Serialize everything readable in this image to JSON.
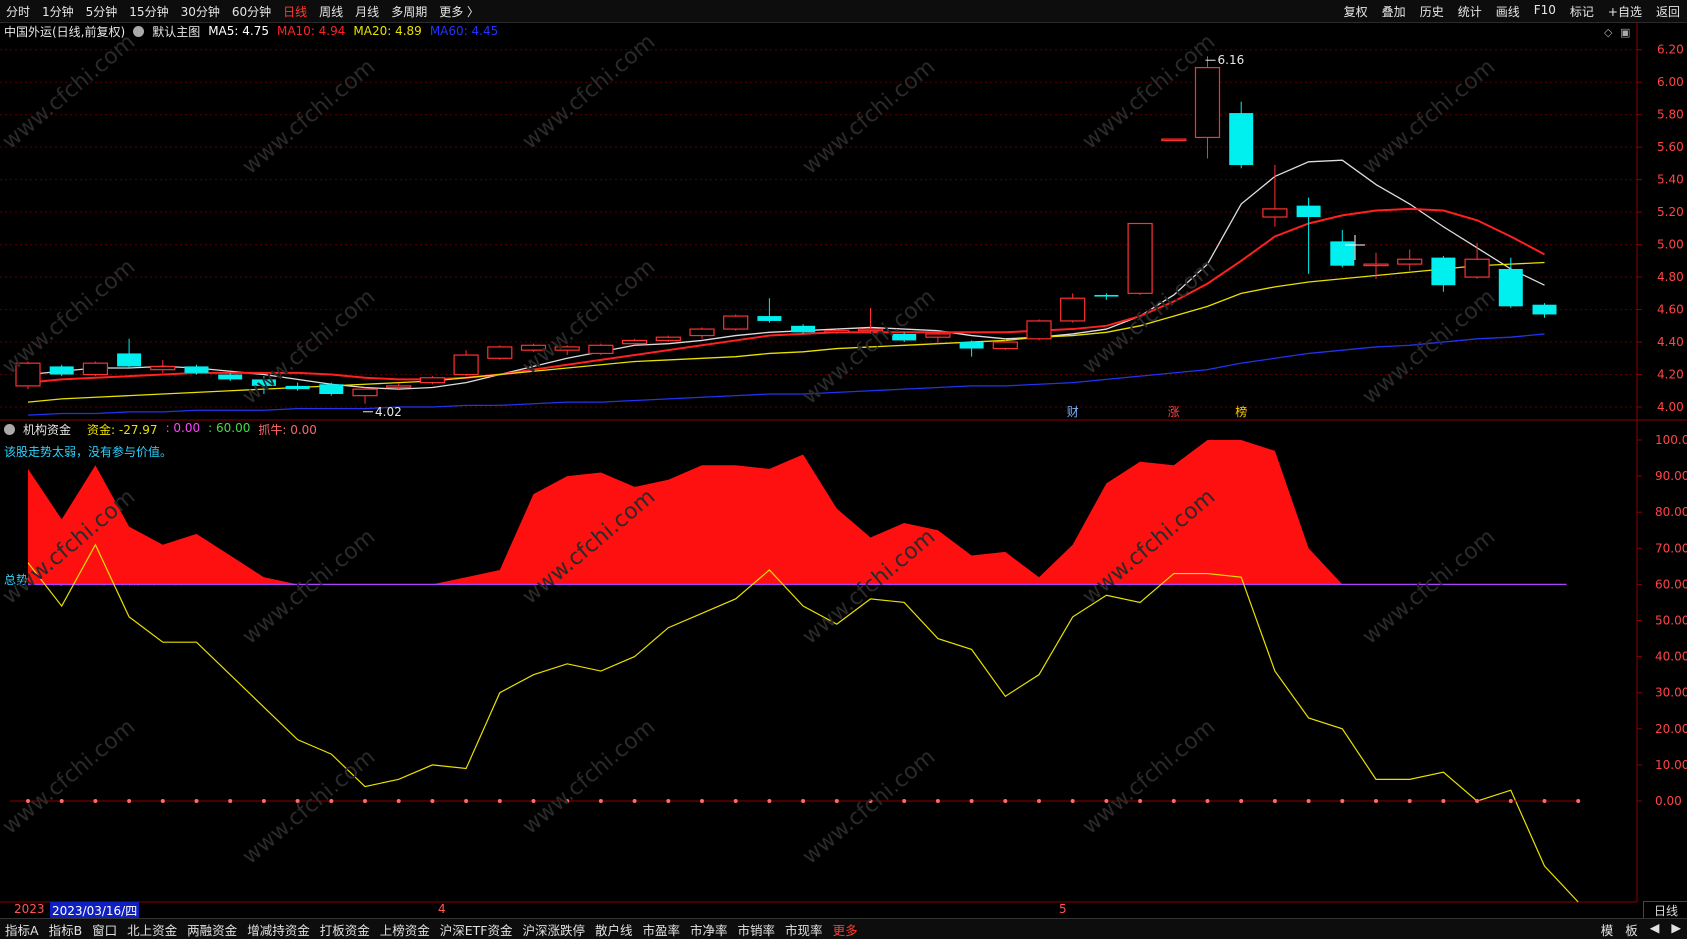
{
  "topbar": {
    "tabs": [
      "分时",
      "1分钟",
      "5分钟",
      "15分钟",
      "30分钟",
      "60分钟",
      "日线",
      "周线",
      "月线",
      "多周期",
      "更多 〉"
    ],
    "active_tab": "日线",
    "right_buttons": [
      "复权",
      "叠加",
      "历史",
      "统计",
      "画线",
      "F10",
      "标记",
      "+自选",
      "返回"
    ]
  },
  "main_chart": {
    "title": "中国外运(日线,前复权)",
    "main_label": "默认主图",
    "ma": [
      {
        "label": "MA5: 4.75",
        "color": "#ffffff"
      },
      {
        "label": "MA10: 4.94",
        "color": "#ff2222"
      },
      {
        "label": "MA20: 4.89",
        "color": "#e8e000"
      },
      {
        "label": "MA60: 4.45",
        "color": "#2233ff"
      }
    ],
    "high_label": "6.16",
    "low_label": "4.02",
    "markers": [
      {
        "text": "财",
        "color": "#7fb3ff"
      },
      {
        "text": "涨",
        "color": "#ff4444"
      },
      {
        "text": "榜",
        "color": "#ffcc00"
      }
    ],
    "yticks": [
      "6.20",
      "6.00",
      "5.80",
      "5.60",
      "5.40",
      "5.20",
      "5.00",
      "4.80",
      "4.60",
      "4.40",
      "4.20",
      "4.00"
    ]
  },
  "indicator": {
    "name": "机构资金",
    "values": [
      {
        "label": "资金: -27.97",
        "color": "#e8e000"
      },
      {
        "label": ": 0.00",
        "color": "#ff44ff"
      },
      {
        "label": ": 60.00",
        "color": "#44dd44"
      },
      {
        "label": "抓牛: 0.00",
        "color": "#ff6666"
      }
    ],
    "note_top": "该股走势太弱，没有参与价值。",
    "note_mid": "总势趋势向下，量能萎缩，不适合进场。",
    "yticks": [
      "100.0",
      "90.00",
      "80.00",
      "70.00",
      "60.00",
      "50.00",
      "40.00",
      "30.00",
      "20.00",
      "10.00",
      "0.00"
    ]
  },
  "dates": {
    "start": "2023",
    "cursor": "2023/03/16/四",
    "m4": "4",
    "m5": "5"
  },
  "period_label": "日线",
  "bottombar": {
    "tabs": [
      "指标A",
      "指标B",
      "窗口",
      "北上资金",
      "两融资金",
      "增减持资金",
      "打板资金",
      "上榜资金",
      "沪深ETF资金",
      "沪深涨跌停",
      "散户线",
      "市盈率",
      "市净率",
      "市销率",
      "市现率",
      "更多"
    ],
    "right": [
      "模",
      "板",
      "◀",
      "▶"
    ]
  },
  "watermark": "www.cfchi.com",
  "chart_data": [
    {
      "type": "candlestick",
      "title": "中国外运(日线,前复权)",
      "ylim": [
        3.92,
        6.26
      ],
      "candles": [
        {
          "o": 4.13,
          "c": 4.27,
          "h": 4.28,
          "l": 4.11
        },
        {
          "o": 4.25,
          "c": 4.2,
          "h": 4.26,
          "l": 4.19
        },
        {
          "o": 4.2,
          "c": 4.27,
          "h": 4.28,
          "l": 4.19
        },
        {
          "o": 4.33,
          "c": 4.25,
          "h": 4.42,
          "l": 4.24
        },
        {
          "o": 4.23,
          "c": 4.25,
          "h": 4.29,
          "l": 4.21
        },
        {
          "o": 4.25,
          "c": 4.21,
          "h": 4.26,
          "l": 4.2
        },
        {
          "o": 4.2,
          "c": 4.17,
          "h": 4.21,
          "l": 4.16
        },
        {
          "o": 4.17,
          "c": 4.13,
          "h": 4.19,
          "l": 4.08
        },
        {
          "o": 4.13,
          "c": 4.11,
          "h": 4.15,
          "l": 4.1
        },
        {
          "o": 4.14,
          "c": 4.08,
          "h": 4.15,
          "l": 4.07
        },
        {
          "o": 4.07,
          "c": 4.11,
          "h": 4.12,
          "l": 4.02
        },
        {
          "o": 4.12,
          "c": 4.13,
          "h": 4.15,
          "l": 4.11
        },
        {
          "o": 4.15,
          "c": 4.18,
          "h": 4.19,
          "l": 4.14
        },
        {
          "o": 4.2,
          "c": 4.32,
          "h": 4.35,
          "l": 4.19
        },
        {
          "o": 4.3,
          "c": 4.37,
          "h": 4.38,
          "l": 4.29
        },
        {
          "o": 4.35,
          "c": 4.38,
          "h": 4.39,
          "l": 4.34
        },
        {
          "o": 4.35,
          "c": 4.37,
          "h": 4.38,
          "l": 4.32
        },
        {
          "o": 4.33,
          "c": 4.38,
          "h": 4.39,
          "l": 4.32
        },
        {
          "o": 4.39,
          "c": 4.41,
          "h": 4.42,
          "l": 4.38
        },
        {
          "o": 4.41,
          "c": 4.43,
          "h": 4.44,
          "l": 4.4
        },
        {
          "o": 4.44,
          "c": 4.48,
          "h": 4.49,
          "l": 4.42
        },
        {
          "o": 4.48,
          "c": 4.56,
          "h": 4.57,
          "l": 4.47
        },
        {
          "o": 4.56,
          "c": 4.53,
          "h": 4.67,
          "l": 4.52
        },
        {
          "o": 4.5,
          "c": 4.46,
          "h": 4.51,
          "l": 4.45
        },
        {
          "o": 4.46,
          "c": 4.47,
          "h": 4.48,
          "l": 4.45
        },
        {
          "o": 4.47,
          "c": 4.48,
          "h": 4.61,
          "l": 4.45
        },
        {
          "o": 4.45,
          "c": 4.41,
          "h": 4.46,
          "l": 4.4
        },
        {
          "o": 4.43,
          "c": 4.45,
          "h": 4.47,
          "l": 4.39
        },
        {
          "o": 4.4,
          "c": 4.36,
          "h": 4.41,
          "l": 4.31
        },
        {
          "o": 4.36,
          "c": 4.4,
          "h": 4.42,
          "l": 4.35
        },
        {
          "o": 4.42,
          "c": 4.53,
          "h": 4.54,
          "l": 4.41
        },
        {
          "o": 4.53,
          "c": 4.67,
          "h": 4.7,
          "l": 4.52
        },
        {
          "o": 4.69,
          "c": 4.68,
          "h": 4.7,
          "l": 4.66
        },
        {
          "o": 4.7,
          "c": 5.13,
          "h": 5.13,
          "l": 4.69
        },
        {
          "o": 5.65,
          "c": 5.65,
          "h": 5.65,
          "l": 5.65
        },
        {
          "o": 5.66,
          "c": 6.09,
          "h": 6.16,
          "l": 5.53
        },
        {
          "o": 5.81,
          "c": 5.49,
          "h": 5.88,
          "l": 5.47
        },
        {
          "o": 5.17,
          "c": 5.22,
          "h": 5.49,
          "l": 5.11
        },
        {
          "o": 5.24,
          "c": 5.17,
          "h": 5.29,
          "l": 4.82
        },
        {
          "o": 5.02,
          "c": 4.87,
          "h": 5.09,
          "l": 4.86
        },
        {
          "o": 4.88,
          "c": 4.88,
          "h": 4.95,
          "l": 4.79
        },
        {
          "o": 4.88,
          "c": 4.91,
          "h": 4.97,
          "l": 4.84
        },
        {
          "o": 4.92,
          "c": 4.75,
          "h": 4.93,
          "l": 4.71
        },
        {
          "o": 4.8,
          "c": 4.91,
          "h": 5.01,
          "l": 4.79
        },
        {
          "o": 4.85,
          "c": 4.62,
          "h": 4.92,
          "l": 4.61
        },
        {
          "o": 4.63,
          "c": 4.57,
          "h": 4.64,
          "l": 4.55
        }
      ],
      "series": [
        {
          "name": "MA5",
          "values": [
            4.2,
            4.22,
            4.24,
            4.24,
            4.25,
            4.24,
            4.22,
            4.2,
            4.17,
            4.14,
            4.12,
            4.11,
            4.12,
            4.15,
            4.2,
            4.25,
            4.3,
            4.34,
            4.38,
            4.39,
            4.41,
            4.44,
            4.46,
            4.47,
            4.48,
            4.49,
            4.48,
            4.47,
            4.44,
            4.42,
            4.43,
            4.45,
            4.48,
            4.56,
            4.69,
            4.88,
            5.25,
            5.42,
            5.51,
            5.52,
            5.37,
            5.25,
            5.11,
            4.98,
            4.85,
            4.75
          ]
        },
        {
          "name": "MA10",
          "values": [
            4.15,
            4.17,
            4.18,
            4.19,
            4.2,
            4.21,
            4.21,
            4.21,
            4.21,
            4.2,
            4.18,
            4.17,
            4.17,
            4.18,
            4.2,
            4.23,
            4.26,
            4.29,
            4.32,
            4.35,
            4.38,
            4.41,
            4.44,
            4.45,
            4.46,
            4.46,
            4.46,
            4.46,
            4.46,
            4.46,
            4.47,
            4.48,
            4.5,
            4.56,
            4.65,
            4.76,
            4.9,
            5.05,
            5.13,
            5.18,
            5.21,
            5.22,
            5.21,
            5.15,
            5.05,
            4.94
          ]
        },
        {
          "name": "MA20",
          "values": [
            4.03,
            4.05,
            4.06,
            4.07,
            4.08,
            4.09,
            4.1,
            4.11,
            4.12,
            4.13,
            4.14,
            4.15,
            4.16,
            4.18,
            4.2,
            4.22,
            4.24,
            4.26,
            4.28,
            4.29,
            4.3,
            4.31,
            4.33,
            4.34,
            4.36,
            4.37,
            4.38,
            4.39,
            4.4,
            4.41,
            4.43,
            4.44,
            4.46,
            4.5,
            4.56,
            4.62,
            4.7,
            4.74,
            4.77,
            4.79,
            4.81,
            4.83,
            4.85,
            4.87,
            4.88,
            4.89
          ]
        },
        {
          "name": "MA60",
          "values": [
            3.95,
            3.96,
            3.96,
            3.97,
            3.97,
            3.98,
            3.98,
            3.98,
            3.99,
            3.99,
            3.99,
            4.0,
            4.0,
            4.01,
            4.01,
            4.02,
            4.03,
            4.03,
            4.04,
            4.05,
            4.06,
            4.07,
            4.08,
            4.08,
            4.09,
            4.1,
            4.11,
            4.12,
            4.13,
            4.13,
            4.14,
            4.15,
            4.17,
            4.19,
            4.21,
            4.23,
            4.27,
            4.3,
            4.33,
            4.35,
            4.37,
            4.38,
            4.4,
            4.42,
            4.43,
            4.45
          ]
        }
      ]
    },
    {
      "type": "area",
      "title": "机构资金",
      "ylim": [
        -27.97,
        100
      ],
      "baseline": 60,
      "series": [
        {
          "name": "",
          "values": [
            92,
            78,
            93,
            76,
            71,
            74,
            68,
            62,
            55,
            50,
            55,
            58,
            60,
            62,
            64,
            85,
            90,
            91,
            87,
            89,
            93,
            93,
            92,
            96,
            81,
            73,
            77,
            75,
            68,
            69,
            62,
            71,
            88,
            94,
            93,
            100,
            100,
            97,
            70,
            55,
            50,
            45,
            40,
            35,
            30,
            25
          ]
        },
        {
          "name": "资金",
          "values": [
            66,
            54,
            71,
            51,
            44,
            44,
            35,
            26,
            17,
            13,
            4,
            6,
            10,
            9,
            30,
            35,
            38,
            36,
            40,
            48,
            52,
            56,
            64,
            54,
            49,
            56,
            55,
            45,
            42,
            29,
            35,
            51,
            57,
            55,
            63,
            63,
            62,
            36,
            23,
            20,
            6,
            6,
            8,
            0,
            3,
            -18,
            -27.97
          ]
        }
      ]
    }
  ]
}
